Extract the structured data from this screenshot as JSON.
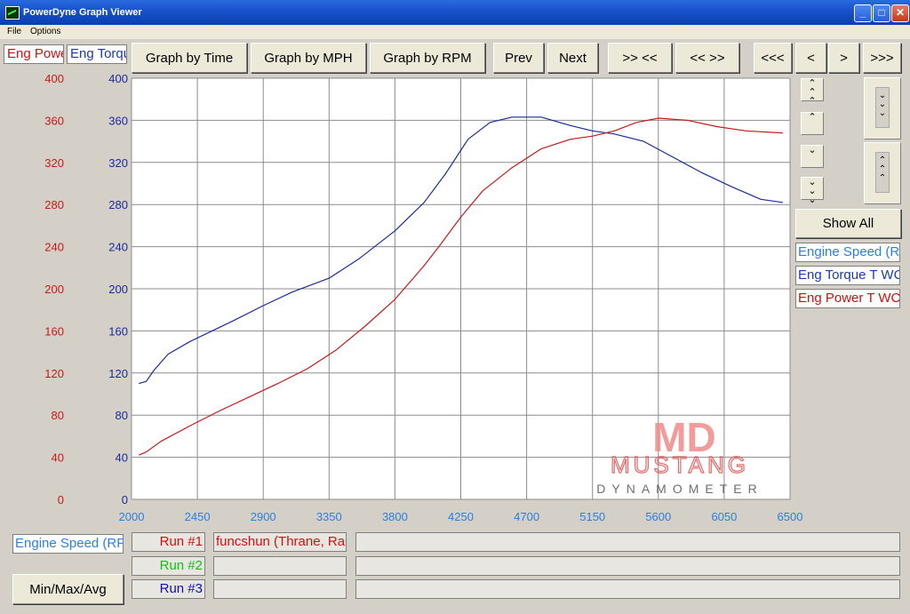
{
  "window": {
    "title": "PowerDyne Graph Viewer"
  },
  "menu": {
    "file": "File",
    "options": "Options"
  },
  "toolbar": {
    "graph_by_time": "Graph by Time",
    "graph_by_mph": "Graph by MPH",
    "graph_by_rpm": "Graph by RPM",
    "prev": "Prev",
    "next": "Next",
    "zoom_in": ">> <<",
    "zoom_out": "<< >>",
    "first": "<<<",
    "back": "<",
    "forward": ">",
    "last": ">>>"
  },
  "legend_top": {
    "power": "Eng Power T",
    "torque": "Eng Torque"
  },
  "side": {
    "show_all": "Show All",
    "channels": [
      "Engine Speed (RPM)",
      "Eng Torque T WC",
      "Eng Power T WC"
    ]
  },
  "bottom": {
    "engine_speed": "Engine Speed (RPM)",
    "minmax": "Min/Max/Avg",
    "runs": [
      {
        "label": "Run #1",
        "color": "#d01010",
        "desc": "funcshun (Thrane, Ra"
      },
      {
        "label": "Run #2",
        "color": "#10c010",
        "desc": ""
      },
      {
        "label": "Run #3",
        "color": "#1010b0",
        "desc": ""
      }
    ]
  },
  "watermark": {
    "logo": "MD",
    "line1": "MUSTANG",
    "line2": "DYNAMOMETER"
  },
  "colors": {
    "power": "#c81818",
    "torque": "#1a2a9c",
    "xaxis": "#2a7fe0"
  },
  "chart_data": {
    "type": "line",
    "x_ticks": [
      2000,
      2450,
      2900,
      3350,
      3800,
      4250,
      4700,
      5150,
      5600,
      6050,
      6500
    ],
    "xlim": [
      2000,
      6500
    ],
    "ylim": [
      0,
      400
    ],
    "y_ticks": [
      0,
      40,
      80,
      120,
      160,
      200,
      240,
      280,
      320,
      360,
      400
    ],
    "series": [
      {
        "name": "Eng Torque T WC",
        "axis": "torque",
        "x": [
          2050,
          2100,
          2150,
          2250,
          2400,
          2550,
          2700,
          2900,
          3100,
          3350,
          3550,
          3800,
          4000,
          4150,
          4300,
          4450,
          4600,
          4800,
          5000,
          5150,
          5300,
          5500,
          5700,
          5900,
          6100,
          6300,
          6450
        ],
        "y": [
          110,
          112,
          122,
          138,
          150,
          160,
          170,
          184,
          197,
          210,
          228,
          255,
          282,
          310,
          342,
          358,
          363,
          363,
          355,
          350,
          347,
          340,
          325,
          310,
          297,
          285,
          282
        ]
      },
      {
        "name": "Eng Power T WC",
        "axis": "power",
        "x": [
          2050,
          2100,
          2200,
          2400,
          2600,
          2800,
          3000,
          3200,
          3400,
          3600,
          3800,
          4000,
          4100,
          4250,
          4400,
          4600,
          4800,
          5000,
          5150,
          5300,
          5450,
          5600,
          5800,
          6000,
          6200,
          6450
        ],
        "y": [
          42,
          45,
          55,
          70,
          84,
          97,
          110,
          124,
          142,
          165,
          190,
          222,
          240,
          268,
          293,
          315,
          333,
          342,
          345,
          350,
          358,
          362,
          360,
          354,
          350,
          348
        ]
      }
    ]
  }
}
